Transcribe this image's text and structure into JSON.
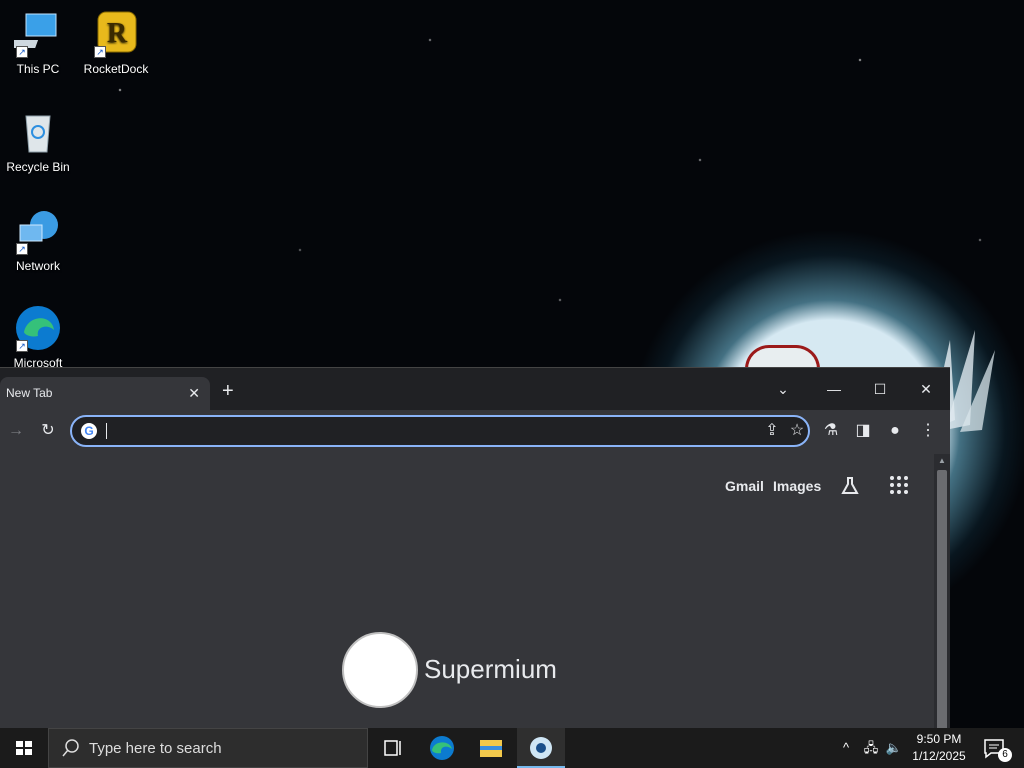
{
  "desktop": {
    "icons": [
      {
        "label": "This PC",
        "icon": "computer-icon"
      },
      {
        "label": "RocketDock",
        "icon": "rocketdock-icon"
      },
      {
        "label": "Recycle Bin",
        "icon": "recycle-bin-icon"
      },
      {
        "label": "Network",
        "icon": "network-icon"
      },
      {
        "label": "Microsoft",
        "icon": "edge-icon"
      }
    ]
  },
  "browser": {
    "tab": {
      "title": "New Tab"
    },
    "omnibox": {
      "value": "",
      "placeholder": ""
    },
    "header_links": {
      "gmail": "Gmail",
      "images": "Images"
    },
    "brand": "Supermium",
    "accent": "#8ab4f8"
  },
  "taskbar": {
    "search_placeholder": "Type here to search",
    "time": "9:50 PM",
    "date": "1/12/2025",
    "notification_count": "6",
    "accent": "#76b9ed"
  }
}
